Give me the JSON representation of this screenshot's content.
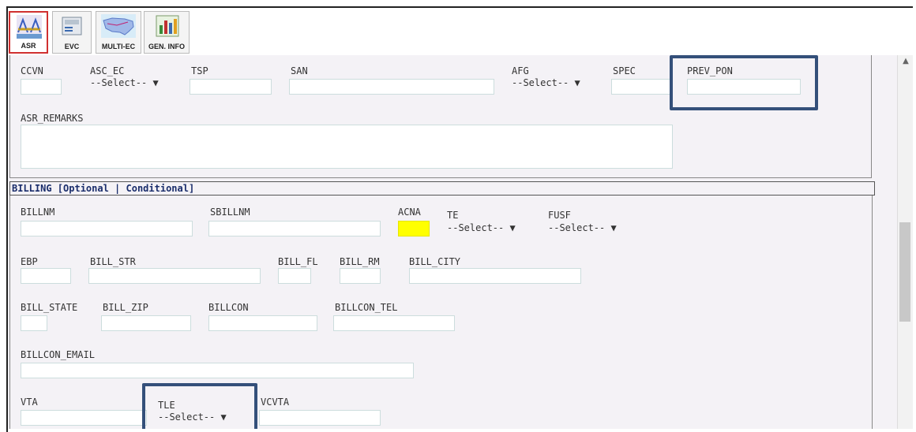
{
  "toolbar": {
    "buttons": [
      {
        "label": "ASR",
        "icon": "bridge-icon"
      },
      {
        "label": "EVC",
        "icon": "fax-machine-icon"
      },
      {
        "label": "MULTI-EC",
        "icon": "usa-map-icon"
      },
      {
        "label": "GEN. INFO",
        "icon": "bar-chart-icon"
      }
    ]
  },
  "top_section": {
    "ccvn": "CCVN",
    "asc_ec": "ASC_EC",
    "asc_ec_value": "--Select-- ▼",
    "tsp": "TSP",
    "san": "SAN",
    "afg": "AFG",
    "afg_value": "--Select-- ▼",
    "spec": "SPEC",
    "prev_pon": "PREV_PON",
    "asr_remarks": "ASR_REMARKS"
  },
  "billing": {
    "header": "BILLING [Optional | Conditional]",
    "billnm": "BILLNM",
    "sbillnm": "SBILLNM",
    "acna": "ACNA",
    "te": "TE",
    "te_value": "--Select-- ▼",
    "fusf": "FUSF",
    "fusf_value": "--Select-- ▼",
    "ebp": "EBP",
    "bill_str": "BILL_STR",
    "bill_fl": "BILL_FL",
    "bill_rm": "BILL_RM",
    "bill_city": "BILL_CITY",
    "bill_state": "BILL_STATE",
    "bill_zip": "BILL_ZIP",
    "billcon": "BILLCON",
    "billcon_tel": "BILLCON_TEL",
    "billcon_email": "BILLCON_EMAIL",
    "vta": "VTA",
    "tle": "TLE",
    "tle_value": "--Select-- ▼",
    "vcvta": "VCVTA"
  },
  "colors": {
    "highlight": "#34507a",
    "acna_fill": "#ffff00",
    "active_tab_border": "#d03030",
    "form_bg": "#f4f2f6"
  },
  "scrollbar": {
    "up_arrow": "▲"
  }
}
